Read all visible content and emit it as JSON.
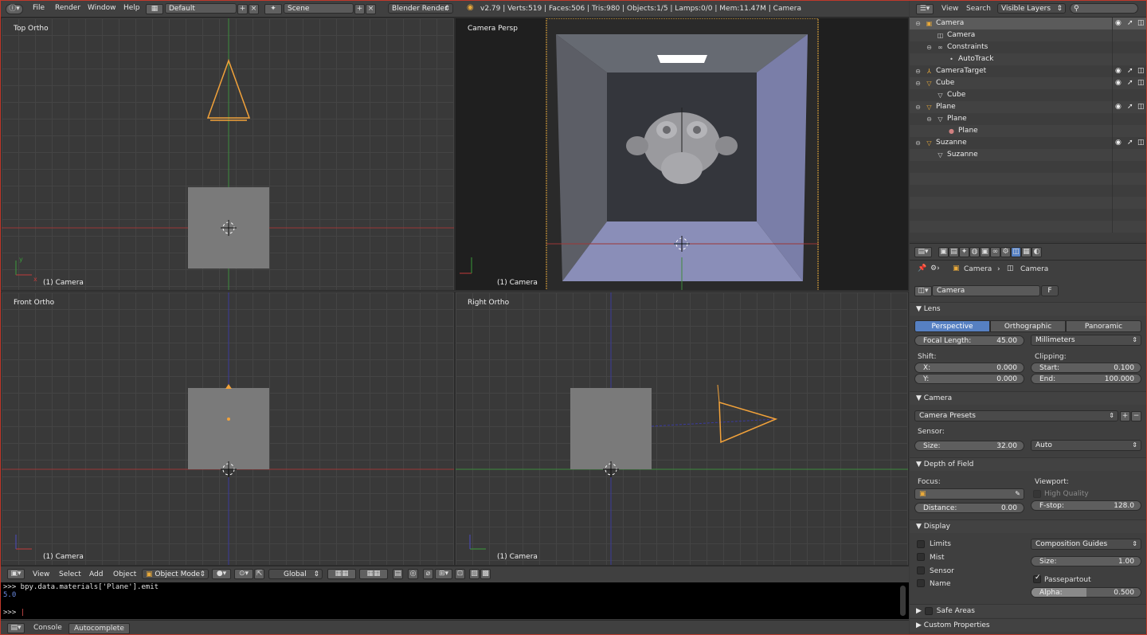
{
  "topbar": {
    "menus": [
      "File",
      "Render",
      "Window",
      "Help"
    ],
    "layout": "Default",
    "scene": "Scene",
    "engine": "Blender Render",
    "info": "v2.79 | Verts:519 | Faces:506 | Tris:980 | Objects:1/5 | Lamps:0/0 | Mem:11.47M | Camera"
  },
  "viewports": {
    "top": {
      "title": "Top Ortho",
      "object": "(1) Camera"
    },
    "camera": {
      "title": "Camera Persp",
      "object": "(1) Camera"
    },
    "front": {
      "title": "Front Ortho",
      "object": "(1) Camera"
    },
    "right": {
      "title": "Right Ortho",
      "object": "(1) Camera"
    }
  },
  "view_header": {
    "menus": [
      "View",
      "Select",
      "Add",
      "Object"
    ],
    "mode": "Object Mode",
    "orientation": "Global"
  },
  "console": {
    "line1": ">>> bpy.data.materials['Plane'].emit",
    "line2": "5.0",
    "prompt": ">>> ",
    "tabs": [
      "Console",
      "Autocomplete"
    ]
  },
  "outliner": {
    "menus": [
      "View",
      "Search"
    ],
    "filter": "Visible Layers",
    "rows": [
      {
        "label": "Camera",
        "indent": 0,
        "icon": "camera-icon",
        "glyph": "▣",
        "color": "#e8a93a",
        "toggles": true
      },
      {
        "label": "Camera",
        "indent": 1,
        "icon": "camera-data-icon",
        "glyph": "◫",
        "color": "#cfcfcf",
        "toggles": false
      },
      {
        "label": "Constraints",
        "indent": 1,
        "icon": "constraints-icon",
        "glyph": "∞",
        "color": "#cfcfcf",
        "toggles": false
      },
      {
        "label": "AutoTrack",
        "indent": 2,
        "icon": "dot-icon",
        "glyph": "•",
        "color": "#cfcfcf",
        "toggles": false
      },
      {
        "label": "CameraTarget",
        "indent": 0,
        "icon": "empty-icon",
        "glyph": "⅄",
        "color": "#e8a93a",
        "toggles": true
      },
      {
        "label": "Cube",
        "indent": 0,
        "icon": "mesh-object-icon",
        "glyph": "▽",
        "color": "#e8a93a",
        "toggles": true
      },
      {
        "label": "Cube",
        "indent": 1,
        "icon": "mesh-data-icon",
        "glyph": "▽",
        "color": "#cfcfcf",
        "toggles": false
      },
      {
        "label": "Plane",
        "indent": 0,
        "icon": "mesh-object-icon",
        "glyph": "▽",
        "color": "#e8a93a",
        "toggles": true
      },
      {
        "label": "Plane",
        "indent": 1,
        "icon": "mesh-data-icon",
        "glyph": "▽",
        "color": "#cfcfcf",
        "toggles": false
      },
      {
        "label": "Plane",
        "indent": 2,
        "icon": "material-icon",
        "glyph": "●",
        "color": "#d08080",
        "toggles": false
      },
      {
        "label": "Suzanne",
        "indent": 0,
        "icon": "mesh-object-icon",
        "glyph": "▽",
        "color": "#e8a93a",
        "toggles": true
      },
      {
        "label": "Suzanne",
        "indent": 1,
        "icon": "mesh-data-icon",
        "glyph": "▽",
        "color": "#cfcfcf",
        "toggles": false
      }
    ]
  },
  "properties": {
    "breadcrumb": [
      "Camera",
      "Camera"
    ],
    "datablock": "Camera",
    "fake_user": "F",
    "lens": {
      "header": "Lens",
      "types": [
        "Perspective",
        "Orthographic",
        "Panoramic"
      ],
      "active_type": "Perspective",
      "focal_label": "Focal Length:",
      "focal_value": "45.00",
      "unit": "Millimeters",
      "shift_label": "Shift:",
      "shift_x_label": "X:",
      "shift_x": "0.000",
      "shift_y_label": "Y:",
      "shift_y": "0.000",
      "clip_label": "Clipping:",
      "clip_start_label": "Start:",
      "clip_start": "0.100",
      "clip_end_label": "End:",
      "clip_end": "100.000"
    },
    "camera": {
      "header": "Camera",
      "presets": "Camera Presets",
      "sensor_label": "Sensor:",
      "size_label": "Size:",
      "size_value": "32.00",
      "fit": "Auto"
    },
    "dof": {
      "header": "Depth of Field",
      "focus_label": "Focus:",
      "viewport_label": "Viewport:",
      "hq_label": "High Quality",
      "distance_label": "Distance:",
      "distance_value": "0.00",
      "fstop_label": "F-stop:",
      "fstop_value": "128.0"
    },
    "display": {
      "header": "Display",
      "limits": "Limits",
      "mist": "Mist",
      "sensor": "Sensor",
      "name": "Name",
      "guides": "Composition Guides",
      "size_label": "Size:",
      "size_value": "1.00",
      "passepartout": "Passepartout",
      "alpha_label": "Alpha:",
      "alpha_value": "0.500",
      "alpha_fraction": 0.5
    },
    "safe_areas": "Safe Areas",
    "custom_props": "Custom Properties"
  }
}
